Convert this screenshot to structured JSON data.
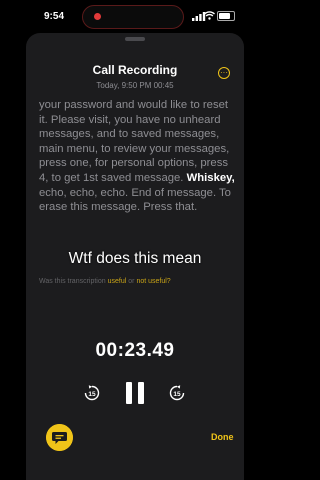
{
  "status_bar": {
    "time": "9:54",
    "battery_level": 0.8
  },
  "header": {
    "title": "Call Recording",
    "subtitle": "Today, 9:50 PM   00:45",
    "more_icon": "ellipsis-circle-icon"
  },
  "transcript": {
    "before": "your password and would like to reset it. Please visit, you have no unheard messages, and to saved messages, main menu, to review your messages, press one, for personal options, press 4, to get 1st saved message.",
    "highlight": "Whiskey,",
    "after": "echo, echo, echo. End of message. To erase this message. Press that."
  },
  "feedback": {
    "prefix": "Was this transcription",
    "useful": "useful",
    "or": "or",
    "not_useful": "not useful?"
  },
  "caption": "Wtf does this mean",
  "player": {
    "elapsed": "00:23.49",
    "skip_back_label": "15",
    "skip_fwd_label": "15"
  },
  "footer": {
    "done_label": "Done"
  },
  "colors": {
    "accent": "#f0c419",
    "sheet": "#1c1c1e",
    "muted": "#8e8e93"
  }
}
